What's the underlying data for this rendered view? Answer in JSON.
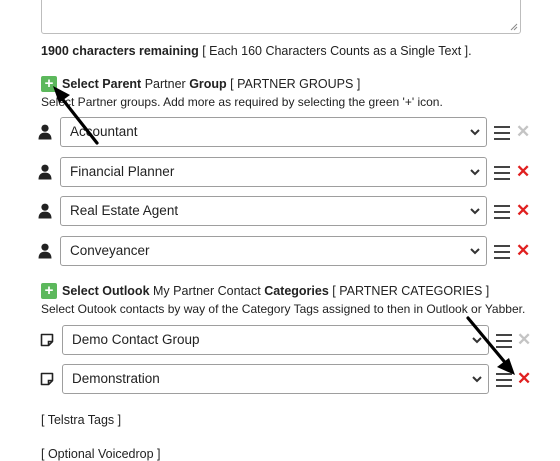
{
  "message": {
    "chars_count": "1900 characters remaining",
    "chars_note": "[ Each 160 Characters Counts as a Single Text ]."
  },
  "partner_section": {
    "bold1": "Select Parent",
    "normal1": "Partner",
    "bold2": "Group",
    "normal2": "[ PARTNER GROUPS ]",
    "description": "Select Partner groups. Add more as required by selecting the green '+' icon.",
    "rows": [
      {
        "value": "Accountant"
      },
      {
        "value": "Financial Planner"
      },
      {
        "value": "Real Estate Agent"
      },
      {
        "value": "Conveyancer"
      }
    ]
  },
  "outlook_section": {
    "bold1": "Select Outlook",
    "normal1": "My Partner Contact",
    "bold2": "Categories",
    "normal2": "[ PARTNER CATEGORIES ]",
    "description": "Select Outook contacts by way of the Category Tags assigned to then in Outlook or Yabber.",
    "rows": [
      {
        "value": "Demo Contact Group"
      },
      {
        "value": "Demonstration"
      }
    ]
  },
  "links": {
    "telstra": "[ Telstra Tags ]",
    "voicedrop": "[ Optional Voicedrop ]"
  },
  "icons": {
    "add": "plus-icon",
    "person": "person-icon",
    "note": "note-icon",
    "menu": "hamburger-icon",
    "remove": "close-icon"
  },
  "colors": {
    "add_green": "#5cb85c",
    "remove_red": "#e02020",
    "disabled_grey": "#c4c4c4"
  }
}
